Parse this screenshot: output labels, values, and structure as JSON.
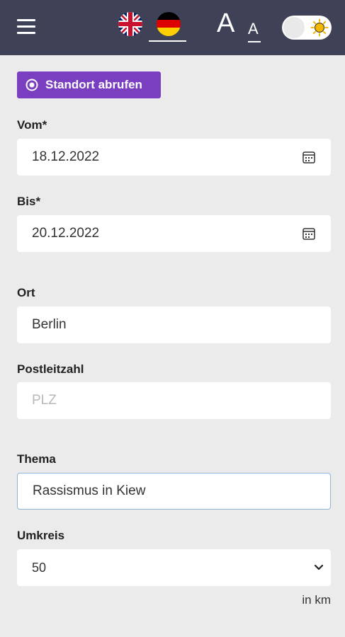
{
  "header": {
    "languages": [
      {
        "code": "en",
        "name": "English",
        "icon": "uk-flag-icon"
      },
      {
        "code": "de",
        "name": "Deutsch",
        "icon": "german-flag-icon",
        "active": true
      }
    ],
    "font_large_label": "A",
    "font_small_label": "A",
    "theme_toggle": {
      "icon": "sun-icon",
      "state": "light"
    }
  },
  "form": {
    "location_button": "Standort abrufen",
    "from_label": "Vom*",
    "from_value": "18.12.2022",
    "to_label": "Bis*",
    "to_value": "20.12.2022",
    "city_label": "Ort",
    "city_value": "Berlin",
    "zip_label": "Postleitzahl",
    "zip_placeholder": "PLZ",
    "topic_label": "Thema",
    "topic_value": "Rassismus in Kiew",
    "radius_label": "Umkreis",
    "radius_value": "50",
    "radius_unit": "in km"
  },
  "colors": {
    "header_bg": "#3f4256",
    "page_bg": "#ebebeb",
    "accent": "#7a3ec0"
  }
}
